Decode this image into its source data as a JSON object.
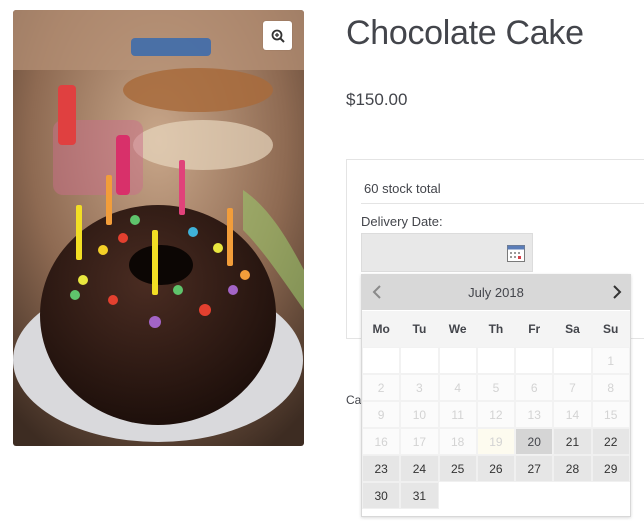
{
  "product": {
    "title": "Chocolate Cake",
    "price": "$150.00",
    "stock_text": "60 stock total",
    "delivery_label": "Delivery Date:",
    "date_value": "",
    "meta_partial": "Cat"
  },
  "icons": {
    "zoom": "magnifier-plus-icon",
    "calendar": "calendar-icon",
    "prev": "chevron-left-icon",
    "next": "chevron-right-icon"
  },
  "datepicker": {
    "month_label": "July 2018",
    "weekdays": [
      "Mo",
      "Tu",
      "We",
      "Th",
      "Fr",
      "Sa",
      "Su"
    ],
    "weeks": [
      [
        {
          "d": "",
          "s": "empty"
        },
        {
          "d": "",
          "s": "empty"
        },
        {
          "d": "",
          "s": "empty"
        },
        {
          "d": "",
          "s": "empty"
        },
        {
          "d": "",
          "s": "empty"
        },
        {
          "d": "",
          "s": "empty"
        },
        {
          "d": "1",
          "s": "disabled"
        }
      ],
      [
        {
          "d": "2",
          "s": "disabled"
        },
        {
          "d": "3",
          "s": "disabled"
        },
        {
          "d": "4",
          "s": "disabled"
        },
        {
          "d": "5",
          "s": "disabled"
        },
        {
          "d": "6",
          "s": "disabled"
        },
        {
          "d": "7",
          "s": "disabled"
        },
        {
          "d": "8",
          "s": "disabled"
        }
      ],
      [
        {
          "d": "9",
          "s": "disabled"
        },
        {
          "d": "10",
          "s": "disabled"
        },
        {
          "d": "11",
          "s": "disabled"
        },
        {
          "d": "12",
          "s": "disabled"
        },
        {
          "d": "13",
          "s": "disabled"
        },
        {
          "d": "14",
          "s": "disabled"
        },
        {
          "d": "15",
          "s": "disabled"
        }
      ],
      [
        {
          "d": "16",
          "s": "disabled"
        },
        {
          "d": "17",
          "s": "disabled"
        },
        {
          "d": "18",
          "s": "disabled"
        },
        {
          "d": "19",
          "s": "today"
        },
        {
          "d": "20",
          "s": "selected"
        },
        {
          "d": "21",
          "s": "available"
        },
        {
          "d": "22",
          "s": "available"
        }
      ],
      [
        {
          "d": "23",
          "s": "available"
        },
        {
          "d": "24",
          "s": "available"
        },
        {
          "d": "25",
          "s": "available"
        },
        {
          "d": "26",
          "s": "available"
        },
        {
          "d": "27",
          "s": "available"
        },
        {
          "d": "28",
          "s": "available"
        },
        {
          "d": "29",
          "s": "available"
        }
      ],
      [
        {
          "d": "30",
          "s": "available"
        },
        {
          "d": "31",
          "s": "available"
        },
        {
          "d": "",
          "s": "blank"
        },
        {
          "d": "",
          "s": "blank"
        },
        {
          "d": "",
          "s": "blank"
        },
        {
          "d": "",
          "s": "blank"
        },
        {
          "d": "",
          "s": "blank"
        }
      ]
    ]
  },
  "colors": {
    "text": "#43454b",
    "header_bg": "#d8d8d8",
    "available_bg": "#e6e6e6",
    "disabled_text": "#d3d3d3"
  }
}
